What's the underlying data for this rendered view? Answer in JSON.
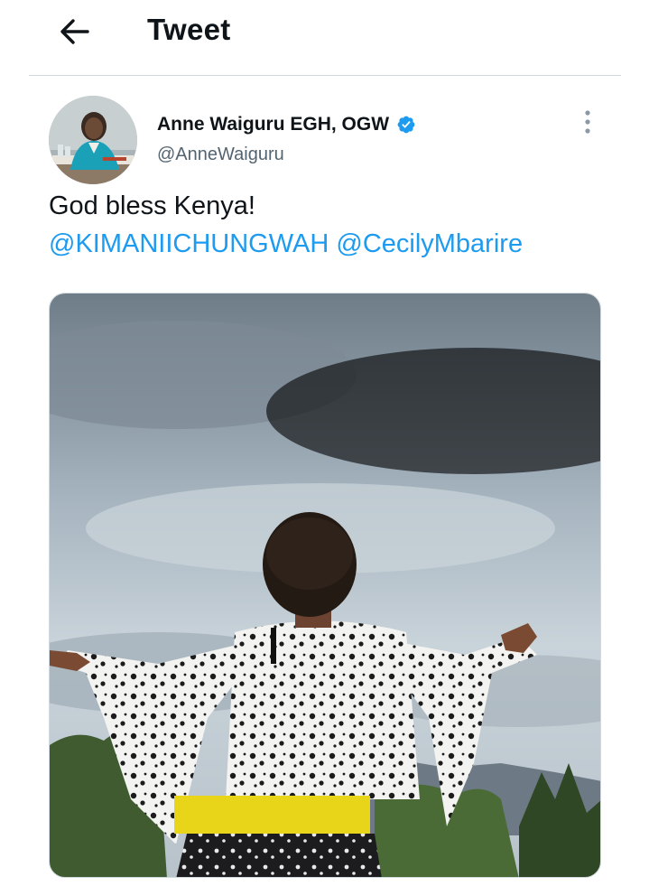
{
  "header": {
    "title": "Tweet",
    "back_icon": "arrow-left-icon"
  },
  "tweet": {
    "author_name": "Anne Waiguru EGH, OGW",
    "author_handle": "@AnneWaiguru",
    "verified": true,
    "text": "God bless Kenya!",
    "mentions": [
      "@KIMANIICHUNGWAH",
      "@CecilyMbarire"
    ]
  },
  "colors": {
    "link": "#1d9bf0",
    "secondary_text": "#536471",
    "divider": "#cfd9de"
  }
}
